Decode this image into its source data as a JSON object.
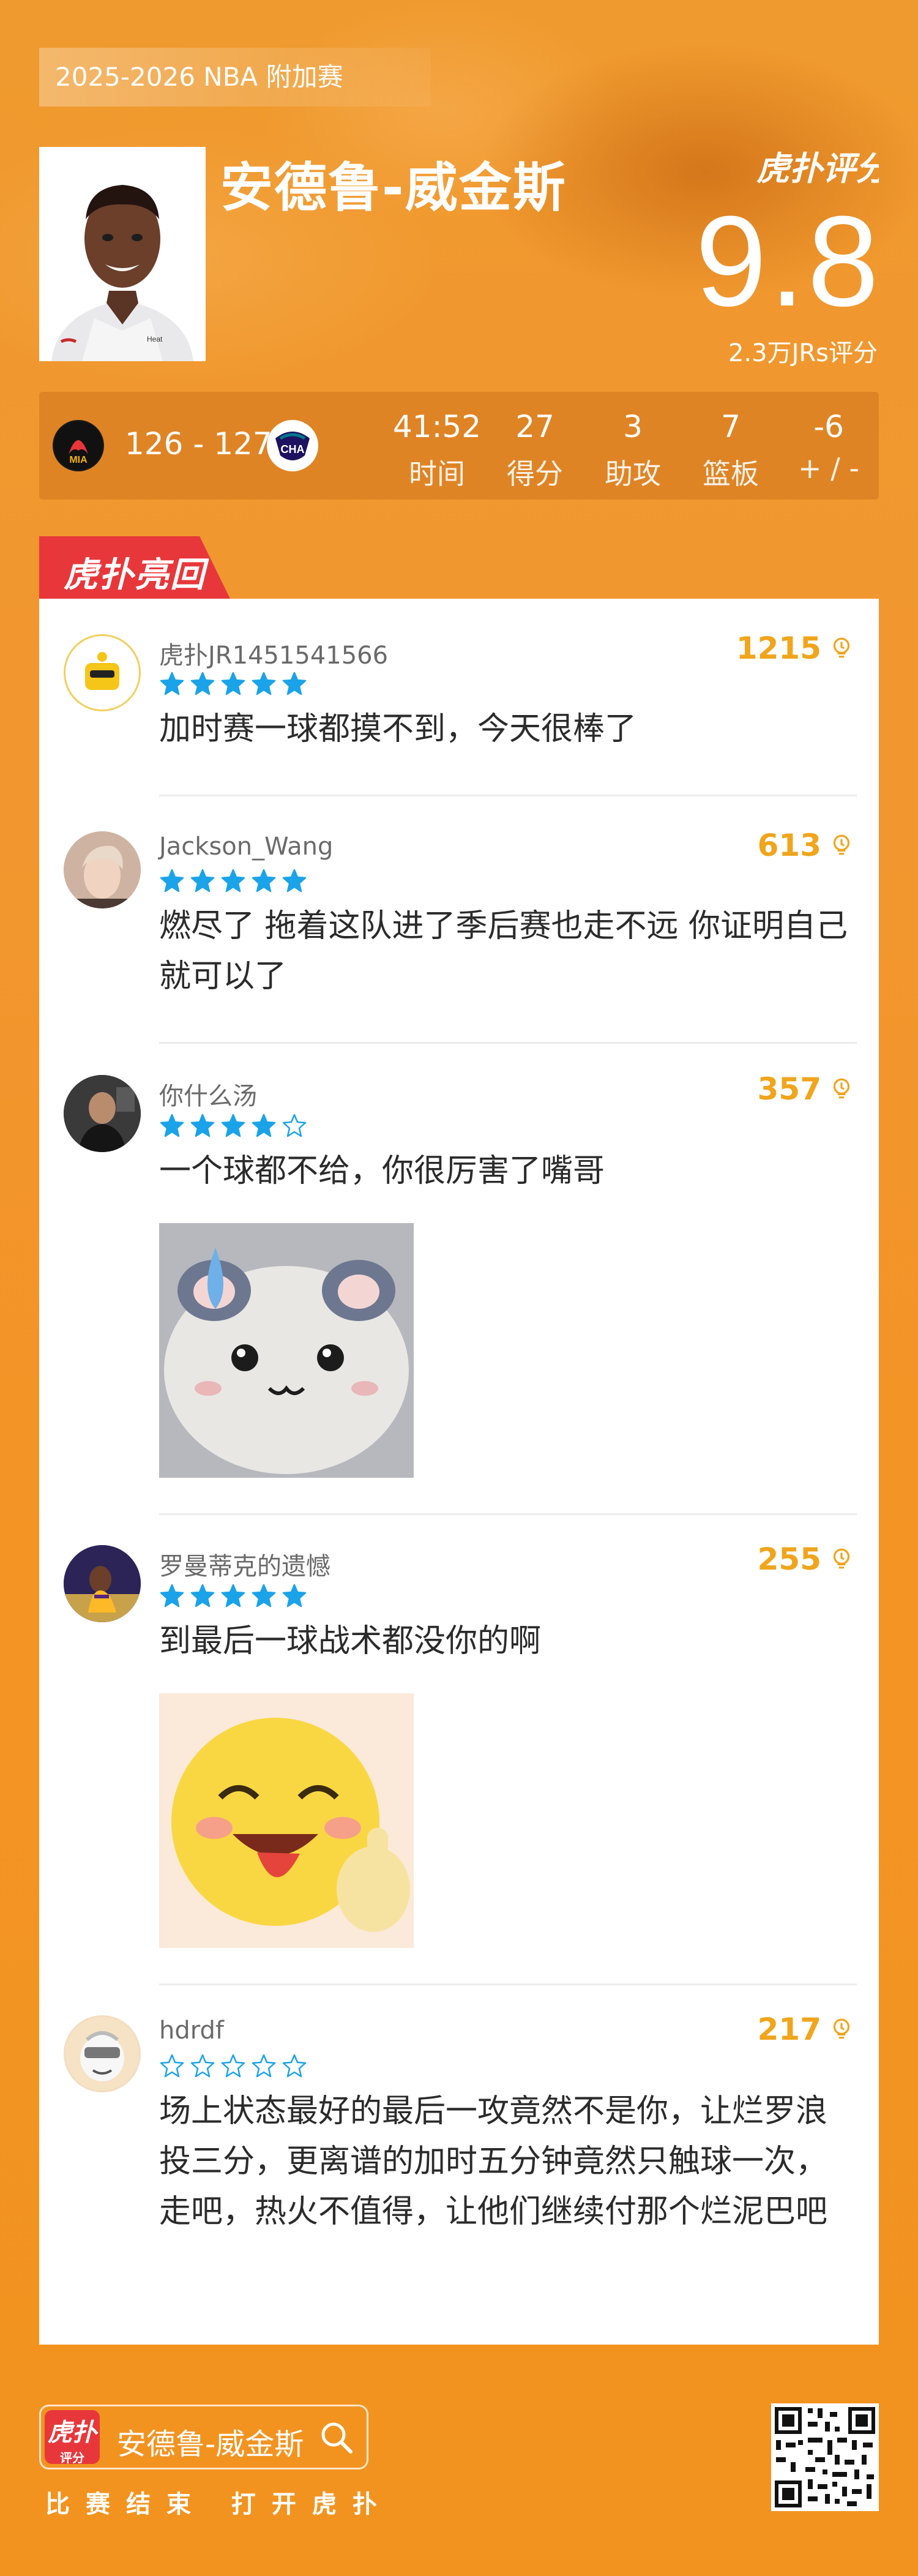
{
  "header": {
    "season_tag": "2025-2026 NBA 附加赛",
    "player_name": "安德鲁-威金斯",
    "brand": "虎扑评分",
    "score": "9.8",
    "rating_count": "2.3万JRs评分"
  },
  "match": {
    "home_abbr": "MIA",
    "away_abbr": "CHA",
    "score": "126 - 127",
    "stats": [
      {
        "value": "41:52",
        "label": "时间"
      },
      {
        "value": "27",
        "label": "得分"
      },
      {
        "value": "3",
        "label": "助攻"
      },
      {
        "value": "7",
        "label": "篮板"
      },
      {
        "value": "-6",
        "label": "+ / -"
      }
    ]
  },
  "section": {
    "badge": "虎扑亮回复"
  },
  "comments": [
    {
      "user": "虎扑JR1451541566",
      "likes": "1215",
      "rating": 5,
      "text": "加时赛一球都摸不到，今天很棒了"
    },
    {
      "user": "Jackson_Wang",
      "likes": "613",
      "rating": 5,
      "text": "燃尽了 拖着这队进了季后赛也走不远 你证明自己就可以了"
    },
    {
      "user": "你什么汤",
      "likes": "357",
      "rating": 4,
      "text": "一个球都不给，你很厉害了嘴哥"
    },
    {
      "user": "罗曼蒂克的遗憾",
      "likes": "255",
      "rating": 5,
      "text": "到最后一球战术都没你的啊"
    },
    {
      "user": "hdrdf",
      "likes": "217",
      "rating": 0,
      "text": "场上状态最好的最后一攻竟然不是你，让烂罗浪投三分，更离谱的加时五分钟竟然只触球一次，走吧，热火不值得，让他们继续付那个烂泥巴吧"
    }
  ],
  "footer": {
    "logo_top": "虎扑",
    "logo_bottom": "评分",
    "search_text": "安德鲁-威金斯",
    "caption": "比赛结束 打开虎扑"
  },
  "colors": {
    "background": "#f2931f",
    "accent_red": "#e8373b",
    "star_blue": "#1aa3e8",
    "likes_gold": "#f0a51c"
  }
}
